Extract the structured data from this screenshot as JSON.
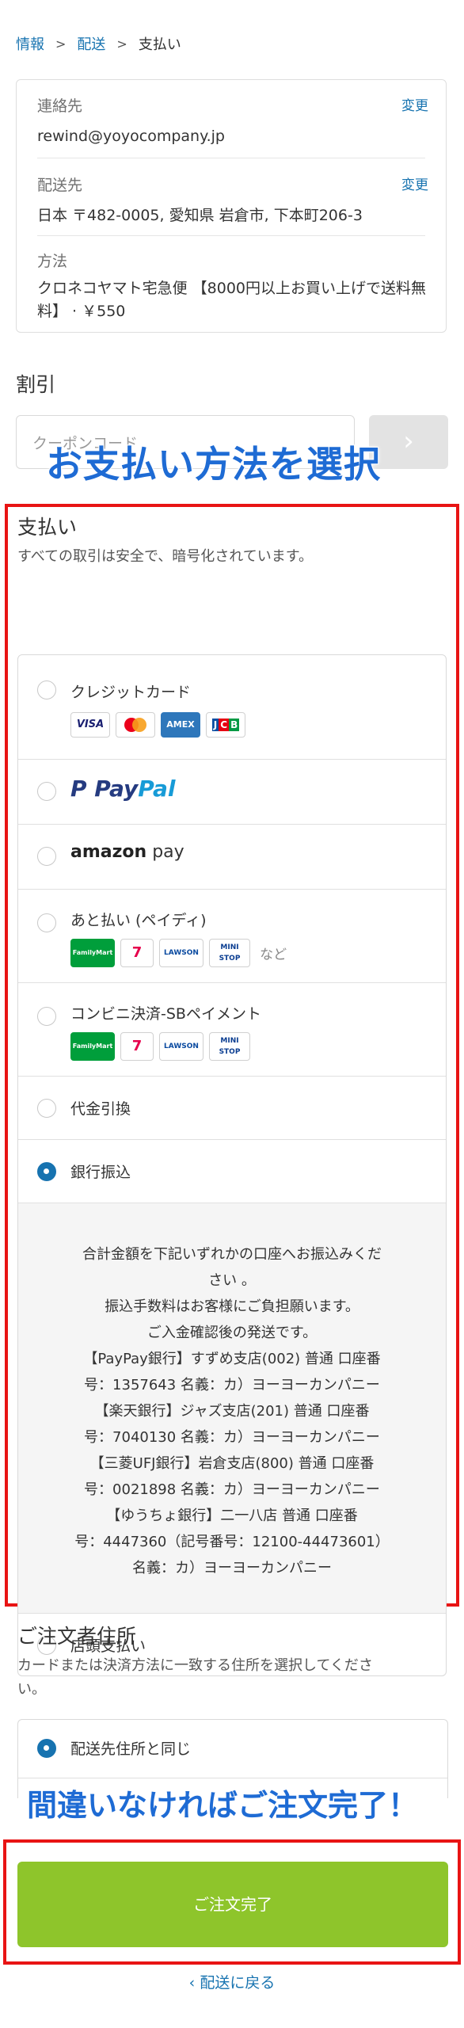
{
  "breadcrumb": {
    "items": [
      "情報",
      "配送",
      "支払い"
    ]
  },
  "summary": {
    "contact_label": "連絡先",
    "contact_value": "rewind@yoyocompany.jp",
    "contact_change": "変更",
    "ship_label": "配送先",
    "ship_value": "日本 〒482-0005, 愛知県 岩倉市, 下本町206-3",
    "ship_change": "変更",
    "method_label": "方法",
    "method_value": "クロネコヤマト宅急便 【8000円以上お買い上げで送料無料】 · ￥550"
  },
  "discount": {
    "title": "割引",
    "placeholder": "クーポンコード",
    "apply_icon": "arrow-right"
  },
  "overlay_top": "お支払い方法を選択",
  "payment": {
    "title": "支払い",
    "subtitle": "すべての取引は安全で、暗号化されています。",
    "options": {
      "credit": "クレジットカード",
      "paypal_pay": "Pay",
      "paypal_pal": "Pal",
      "amazon_amazon": "amazon",
      "amazon_pay": "pay",
      "paidy": "あと払い (ペイディ)",
      "paidy_etc": "など",
      "konbini": "コンビニ決済-SBペイメント",
      "cod": "代金引換",
      "bank": "銀行振込",
      "store": "店頭支払い"
    },
    "cards": {
      "visa": "VISA",
      "amex": "AMEX",
      "jcb": "JCB"
    },
    "stores": {
      "familymart": "FamilyMart",
      "seven": "7",
      "lawson": "LAWSON",
      "ministop": "MINI STOP"
    },
    "selected": "bank",
    "bank_lines": [
      "合計金額を下記いずれかの口座へお振込みくだ",
      "さい 。",
      "振込手数料はお客様にご負担願います。",
      "ご入金確認後の発送です。",
      "【PayPay銀行】すずめ支店(002) 普通 口座番",
      "号：1357643 名義：カ）ヨーヨーカンパニー",
      "【楽天銀行】ジャズ支店(201) 普通 口座番",
      "号：7040130 名義：カ）ヨーヨーカンパニー",
      "【三菱UFJ銀行】岩倉支店(800) 普通 口座番",
      "号：0021898 名義：カ）ヨーヨーカンパニー",
      "【ゆうちょ銀行】二一八店 普通 口座番",
      "号：4447360（記号番号：12100-44473601）",
      "名義：カ）ヨーヨーカンパニー"
    ]
  },
  "billing": {
    "title": "ご注文者住所",
    "subtitle_1": "カードまたは決済方法に一致する住所を選択してくださ",
    "subtitle_2": "い。",
    "same": "配送先住所と同じ"
  },
  "overlay_bottom": "間違いなければご注文完了！",
  "submit_label": "ご注文完了",
  "back_label": "配送に戻る",
  "colors": {
    "accent": "#1773b0",
    "submit": "#8ec52b",
    "highlight": "#e81414",
    "overlay": "#1e6bd4"
  }
}
